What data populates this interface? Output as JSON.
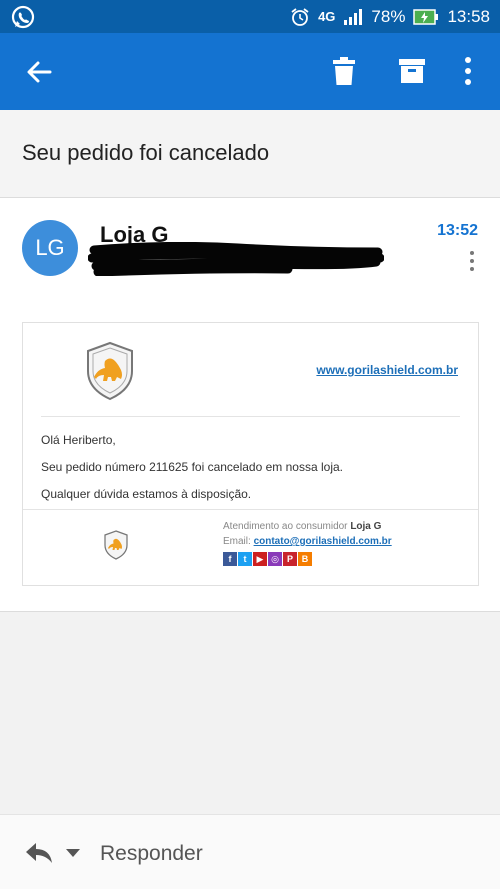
{
  "status_bar": {
    "battery": "78%",
    "time": "13:58",
    "network": "4G",
    "icons": [
      "whatsapp-icon",
      "alarm-icon",
      "signal-icon",
      "battery-charging-icon"
    ]
  },
  "app_bar": {
    "actions": [
      "back-arrow-icon",
      "trash-icon",
      "archive-icon",
      "more-vert-icon"
    ],
    "color": "#1473d1"
  },
  "subject": "Seu pedido foi cancelado",
  "message": {
    "avatar_initials": "LG",
    "sender": "Loja G",
    "time": "13:52"
  },
  "email": {
    "site_link": "www.gorilashield.com.br",
    "greeting": "Olá Heriberto,",
    "line1": "Seu pedido número 211625 foi cancelado em nossa loja.",
    "line2": "Qualquer dúvida estamos à disposição.",
    "footer_label": "Atendimento ao consumidor",
    "footer_store": "Loja G",
    "footer_email_label": "Email:",
    "footer_email": "contato@gorilashield.com.br",
    "socials": [
      {
        "glyph": "f",
        "color": "#3b5998",
        "name": "facebook"
      },
      {
        "glyph": "t",
        "color": "#1da1f2",
        "name": "twitter"
      },
      {
        "glyph": "▶",
        "color": "#cc2020",
        "name": "youtube"
      },
      {
        "glyph": "◎",
        "color": "#8a3ab9",
        "name": "instagram"
      },
      {
        "glyph": "P",
        "color": "#c8232c",
        "name": "pinterest"
      },
      {
        "glyph": "B",
        "color": "#f57d00",
        "name": "blogger"
      }
    ]
  },
  "bottom_bar": {
    "reply_label": "Responder"
  }
}
